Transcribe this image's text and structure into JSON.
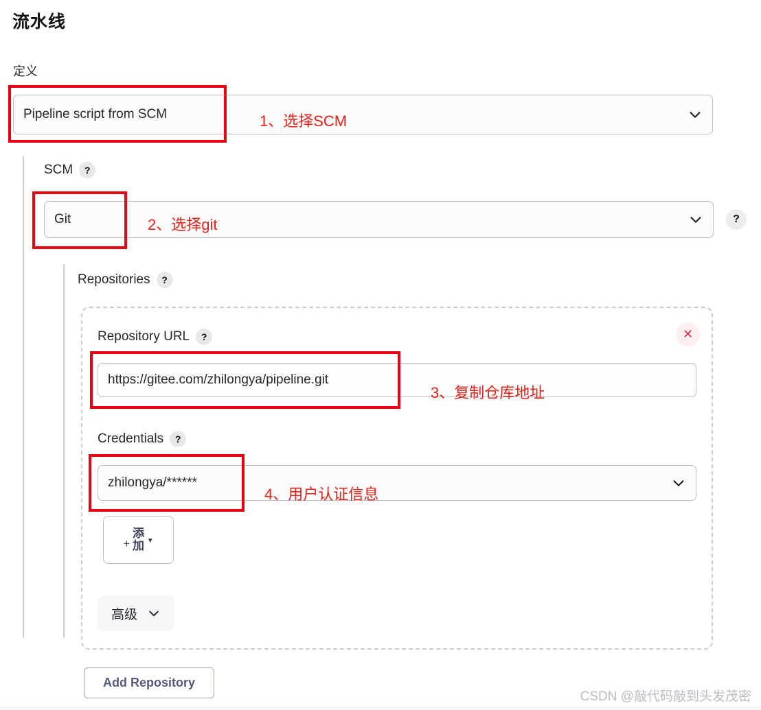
{
  "page": {
    "title": "流水线",
    "definition_label": "定义"
  },
  "definition": {
    "selected": "Pipeline script from SCM",
    "chevron_icon": "chevron-down-icon"
  },
  "scm": {
    "label": "SCM",
    "help_icon": "question-mark-icon",
    "selected": "Git",
    "chevron_icon": "chevron-down-icon",
    "side_help_icon": "question-mark-icon"
  },
  "repositories": {
    "label": "Repositories",
    "help_icon": "question-mark-icon",
    "remove_icon": "close-icon",
    "repository_url": {
      "label": "Repository URL",
      "help_icon": "question-mark-icon",
      "value": "https://gitee.com/zhilongya/pipeline.git",
      "placeholder": ""
    },
    "credentials": {
      "label": "Credentials",
      "help_icon": "question-mark-icon",
      "selected": "zhilongya/******",
      "chevron_icon": "chevron-down-icon"
    },
    "add_credential_button": {
      "plus_icon": "plus-icon",
      "label": "添加",
      "caret_icon": "caret-down-icon"
    },
    "advanced_button": {
      "label": "高级",
      "chevron_icon": "chevron-down-icon"
    },
    "add_repository_button": "Add Repository"
  },
  "annotations": [
    {
      "text": "1、选择SCM"
    },
    {
      "text": "2、选择git"
    },
    {
      "text": "3、复制仓库地址"
    },
    {
      "text": "4、用户认证信息"
    }
  ],
  "watermark": "CSDN @敲代码敲到头发茂密",
  "colors": {
    "annotation_red": "#e2231a",
    "box_red": "#e60012",
    "border_gray": "#b6bfc7",
    "dashed_gray": "#c7ccd2",
    "remove_red": "#d32f45"
  }
}
